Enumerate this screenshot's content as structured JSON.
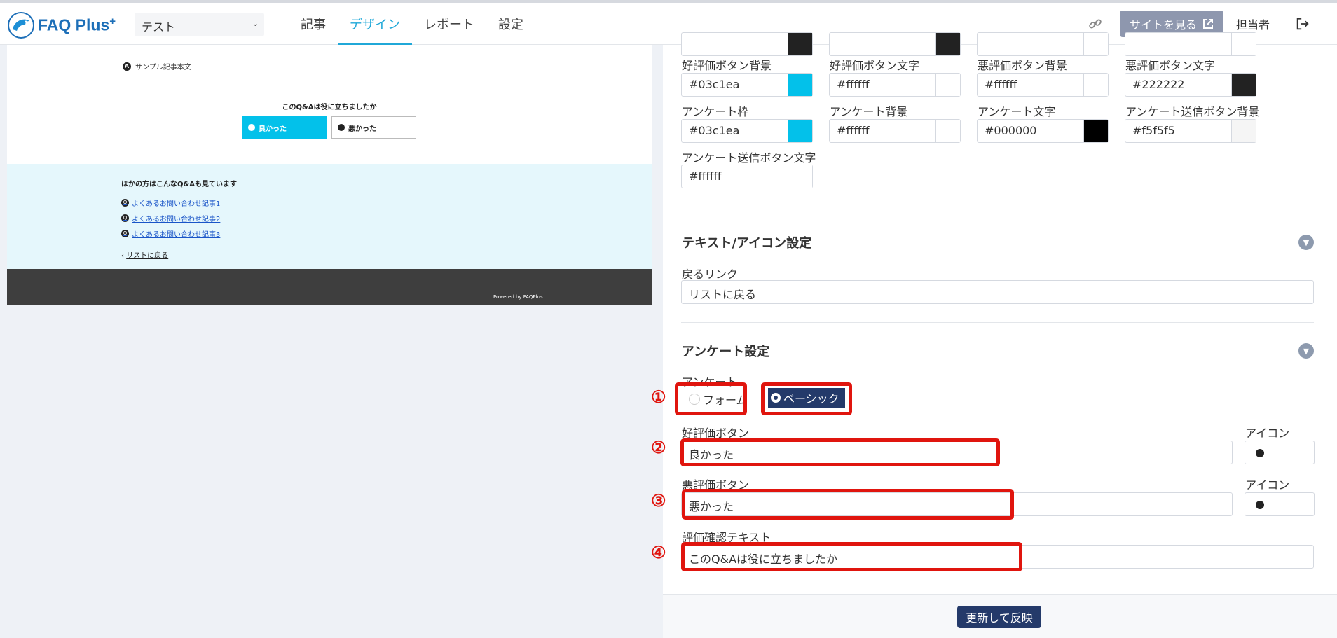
{
  "header": {
    "logo_text": "FAQ Plus",
    "logo_plus": "+",
    "site_select": "テスト",
    "nav": [
      {
        "label": "記事",
        "active": false
      },
      {
        "label": "デザイン",
        "active": true
      },
      {
        "label": "レポート",
        "active": false
      },
      {
        "label": "設定",
        "active": false
      }
    ],
    "view_site_label": "サイトを見る",
    "user_label": "担当者"
  },
  "preview": {
    "sample_text": "サンプル記事本文",
    "question": "このQ&Aは役に立ちましたか",
    "good_button": "良かった",
    "bad_button": "悪かった",
    "related_title": "ほかの方はこんなQ&Aも見ています",
    "related_links": [
      "よくあるお問い合わせ記事1",
      "よくあるお問い合わせ記事2",
      "よくあるお問い合わせ記事3"
    ],
    "back_link": "リストに戻る",
    "powered_by": "Powered by FAQPlus"
  },
  "colors": [
    {
      "label": "好評価ボタン背景",
      "value": "#03c1ea",
      "swatch": "#03c1ea"
    },
    {
      "label": "好評価ボタン文字",
      "value": "#ffffff",
      "swatch": "#ffffff"
    },
    {
      "label": "悪評価ボタン背景",
      "value": "#ffffff",
      "swatch": "#ffffff"
    },
    {
      "label": "悪評価ボタン文字",
      "value": "#222222",
      "swatch": "#222222"
    },
    {
      "label": "アンケート枠",
      "value": "#03c1ea",
      "swatch": "#03c1ea"
    },
    {
      "label": "アンケート背景",
      "value": "#ffffff",
      "swatch": "#ffffff"
    },
    {
      "label": "アンケート文字",
      "value": "#000000",
      "swatch": "#000000"
    },
    {
      "label": "アンケート送信ボタン背景",
      "value": "#f5f5f5",
      "swatch": "#f5f5f5"
    },
    {
      "label": "アンケート送信ボタン文字",
      "value": "#ffffff",
      "swatch": "#ffffff"
    }
  ],
  "text_icon_section": {
    "title": "テキスト/アイコン設定",
    "back_link_label": "戻るリンク",
    "back_link_value": "リストに戻る"
  },
  "survey_section": {
    "title": "アンケート設定",
    "survey_label": "アンケート",
    "option_form": "フォーム",
    "option_basic": "ベーシック",
    "selected": "ベーシック",
    "good_label": "好評価ボタン",
    "good_value": "良かった",
    "bad_label": "悪評価ボタン",
    "bad_value": "悪かった",
    "icon_label": "アイコン",
    "confirm_label": "評価確認テキスト",
    "confirm_value": "このQ&Aは役に立ちましたか"
  },
  "annotations": [
    "①",
    "②",
    "③",
    "④"
  ],
  "update_button": "更新して反映",
  "accent_color": "#20a8d8",
  "primary_dark": "#243a6a",
  "annotation_color": "#e0150e"
}
